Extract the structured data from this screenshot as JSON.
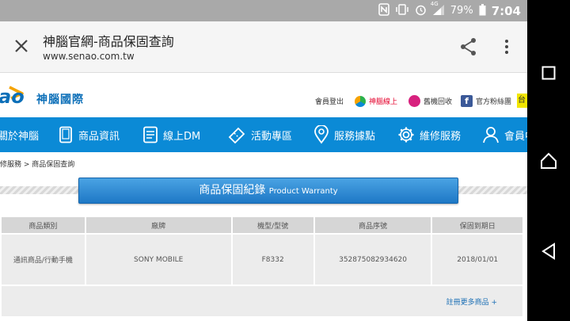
{
  "status_bar": {
    "battery": "79%",
    "time": "7:04",
    "network": "4G"
  },
  "browser": {
    "title": "神腦官網-商品保固查詢",
    "url": "www.senao.com.tw"
  },
  "site": {
    "logo_partial": "ao",
    "logo_text": "神腦國際",
    "top_links": {
      "logout": "會員登出",
      "online": "神腦線上",
      "recycle": "舊機回收",
      "fans": "官方粉絲團",
      "edge": "台"
    },
    "nav": [
      {
        "label": "關於神腦",
        "icon": ""
      },
      {
        "label": "商品資訊",
        "icon": "phone-icon"
      },
      {
        "label": "線上DM",
        "icon": "document-icon"
      },
      {
        "label": "活動專區",
        "icon": "ticket-icon"
      },
      {
        "label": "服務據點",
        "icon": "location-pin-icon"
      },
      {
        "label": "維修服務",
        "icon": "gear-icon"
      },
      {
        "label": "會員中",
        "icon": "user-icon"
      }
    ],
    "breadcrumb": "修服務 > 商品保固查詢"
  },
  "warranty": {
    "title_zh": "商品保固紀錄",
    "title_en": "Product Warranty",
    "headers": [
      "商品類別",
      "廠牌",
      "機型/型號",
      "商品序號",
      "保固到期日"
    ],
    "rows": [
      [
        "通訊商品/行動手機",
        "SONY MOBILE",
        "F8332",
        "352875082934620",
        "2018/01/01"
      ]
    ],
    "register_more": "註冊更多商品 +"
  },
  "colors": {
    "nav_blue": "#0b8ad6",
    "status_gray": "#a9a9a9",
    "banner_blue": "#2a84cf"
  }
}
